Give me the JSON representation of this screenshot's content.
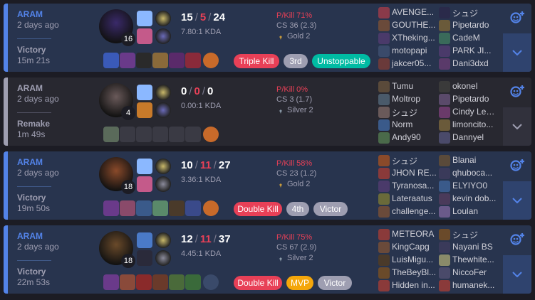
{
  "matches": [
    {
      "type": "win",
      "mode": "ARAM",
      "time_ago": "2 days ago",
      "result": "Victory",
      "length": "15m 21s",
      "level": "16",
      "kills": "15",
      "deaths": "5",
      "assists": "24",
      "kda_ratio": "7.80:1 KDA",
      "p_kill": "P/Kill 71%",
      "cs": "CS 36 (2.3)",
      "tier": "Gold 2",
      "tier_color": "#c89b3c",
      "champ_color": "#3a2a6a",
      "spell_colors": [
        "#8bb8ff",
        "#c45a8a"
      ],
      "rune_colors": [
        "#c8b86a",
        "#6a6ab8"
      ],
      "item_colors": [
        "#3a5ab8",
        "#6a3a8a",
        "#2a2a2a",
        "#8a6a3a",
        "#5a2a6a",
        "#8a2a3a",
        "#c86a2a"
      ],
      "badges": [
        {
          "label": "Triple Kill",
          "color": "#e84057"
        },
        {
          "label": "3rd",
          "color": "#9e9eb1"
        },
        {
          "label": "Unstoppable",
          "color": "#00bba3"
        }
      ],
      "team_left": [
        {
          "name": "AVENGE...",
          "color": "#8a3a4a"
        },
        {
          "name": "GOUTHE...",
          "color": "#6a4a3a"
        },
        {
          "name": "XTheking...",
          "color": "#4a3a6a"
        },
        {
          "name": "motopapi",
          "color": "#3a4a6a"
        },
        {
          "name": "jakcer05...",
          "color": "#6a3a3a"
        }
      ],
      "team_right": [
        {
          "name": "シュジ",
          "color": "#2a2a4a"
        },
        {
          "name": "Pipetardo",
          "color": "#6a5a3a"
        },
        {
          "name": "CadeM",
          "color": "#3a6a5a"
        },
        {
          "name": "PARK JI...",
          "color": "#4a3a6a"
        },
        {
          "name": "Dani3dxd",
          "color": "#5a3a6a"
        }
      ]
    },
    {
      "type": "remake",
      "mode": "ARAM",
      "time_ago": "2 days ago",
      "result": "Remake",
      "length": "1m 49s",
      "level": "4",
      "kills": "0",
      "deaths": "0",
      "assists": "0",
      "kda_ratio": "0.00:1 KDA",
      "p_kill": "P/Kill 0%",
      "cs": "CS 3 (1.7)",
      "tier": "Silver 2",
      "tier_color": "#8a9aa8",
      "champ_color": "#6a5a5a",
      "spell_colors": [
        "#8bb8ff",
        "#c87a2a"
      ],
      "rune_colors": [
        "#c8b86a",
        "#6a6ab8"
      ],
      "item_colors": [
        "#5a6a5a",
        "#3a3a44",
        "#3a3a44",
        "#3a3a44",
        "#3a3a44",
        "#3a3a44",
        "#c86a2a"
      ],
      "badges": [],
      "team_left": [
        {
          "name": "Tumu",
          "color": "#5a4a3a"
        },
        {
          "name": "Moltrop",
          "color": "#4a5a6a"
        },
        {
          "name": "シュジ",
          "color": "#6a5a5a"
        },
        {
          "name": "Norm",
          "color": "#3a5a8a"
        },
        {
          "name": "Andy90",
          "color": "#4a6a4a"
        }
      ],
      "team_right": [
        {
          "name": "okonel",
          "color": "#3a3a3a"
        },
        {
          "name": "Pipetardo",
          "color": "#5a4a6a"
        },
        {
          "name": "Cindy Lee...",
          "color": "#6a3a6a"
        },
        {
          "name": "limoncito...",
          "color": "#6a5a3a"
        },
        {
          "name": "Dannyel",
          "color": "#4a4a6a"
        }
      ]
    },
    {
      "type": "win",
      "mode": "ARAM",
      "time_ago": "2 days ago",
      "result": "Victory",
      "length": "19m 50s",
      "level": "18",
      "kills": "10",
      "deaths": "11",
      "assists": "27",
      "kda_ratio": "3.36:1 KDA",
      "p_kill": "P/Kill 58%",
      "cs": "CS 23 (1.2)",
      "tier": "Gold 2",
      "tier_color": "#c89b3c",
      "champ_color": "#8a4a2a",
      "spell_colors": [
        "#8bb8ff",
        "#c45a8a"
      ],
      "rune_colors": [
        "#c8b86a",
        "#8a8a9a"
      ],
      "item_colors": [
        "#6a3a8a",
        "#8a4a6a",
        "#3a5a8a",
        "#5a8a6a",
        "#4a3a2a",
        "#3a4a8a",
        "#c86a2a"
      ],
      "badges": [
        {
          "label": "Double Kill",
          "color": "#e84057"
        },
        {
          "label": "4th",
          "color": "#9e9eb1"
        },
        {
          "label": "Victor",
          "color": "#9e9eb1"
        }
      ],
      "team_left": [
        {
          "name": "シュジ",
          "color": "#8a4a2a"
        },
        {
          "name": "JHON RE...",
          "color": "#8a3a3a"
        },
        {
          "name": "Tyranosa...",
          "color": "#4a3a6a"
        },
        {
          "name": "Lateraatus",
          "color": "#6a6a3a"
        },
        {
          "name": "challenge...",
          "color": "#6a4a3a"
        }
      ],
      "team_right": [
        {
          "name": "Blanai",
          "color": "#5a4a3a"
        },
        {
          "name": "qhuboca...",
          "color": "#3a3a5a"
        },
        {
          "name": "ELYIYO0",
          "color": "#3a5a8a"
        },
        {
          "name": "kevin dob...",
          "color": "#4a3a5a"
        },
        {
          "name": "Loulan",
          "color": "#6a5a8a"
        }
      ]
    },
    {
      "type": "win",
      "mode": "ARAM",
      "time_ago": "2 days ago",
      "result": "Victory",
      "length": "22m 53s",
      "level": "18",
      "kills": "12",
      "deaths": "11",
      "assists": "37",
      "kda_ratio": "4.45:1 KDA",
      "p_kill": "P/Kill 75%",
      "cs": "CS 67 (2.9)",
      "tier": "Silver 2",
      "tier_color": "#8a9aa8",
      "champ_color": "#6a4a2a",
      "spell_colors": [
        "#4a7ac8",
        "#2a2a3a"
      ],
      "rune_colors": [
        "#c8b86a",
        "#8a8a9a"
      ],
      "item_colors": [
        "#6a3a8a",
        "#8a4a3a",
        "#8a2a2a",
        "#6a3a2a",
        "#4a6a3a",
        "#3a6a3a",
        "#3a4a6a"
      ],
      "badges": [
        {
          "label": "Double Kill",
          "color": "#e84057"
        },
        {
          "label": "MVP",
          "color": "#f4a60a"
        },
        {
          "label": "Victor",
          "color": "#9e9eb1"
        }
      ],
      "team_left": [
        {
          "name": "METEORA",
          "color": "#8a3a3a"
        },
        {
          "name": "KingCapg",
          "color": "#6a4a3a"
        },
        {
          "name": "LuisMigu...",
          "color": "#4a3a2a"
        },
        {
          "name": "TheBeyBl...",
          "color": "#6a4a2a"
        },
        {
          "name": "Hidden in...",
          "color": "#8a3a3a"
        }
      ],
      "team_right": [
        {
          "name": "シュジ",
          "color": "#6a4a2a"
        },
        {
          "name": "Nayani BS",
          "color": "#3a3a5a"
        },
        {
          "name": "Thewhite...",
          "color": "#8a8a6a"
        },
        {
          "name": "NiccoFer",
          "color": "#4a4a6a"
        },
        {
          "name": "humanek...",
          "color": "#8a3a3a"
        }
      ]
    }
  ]
}
